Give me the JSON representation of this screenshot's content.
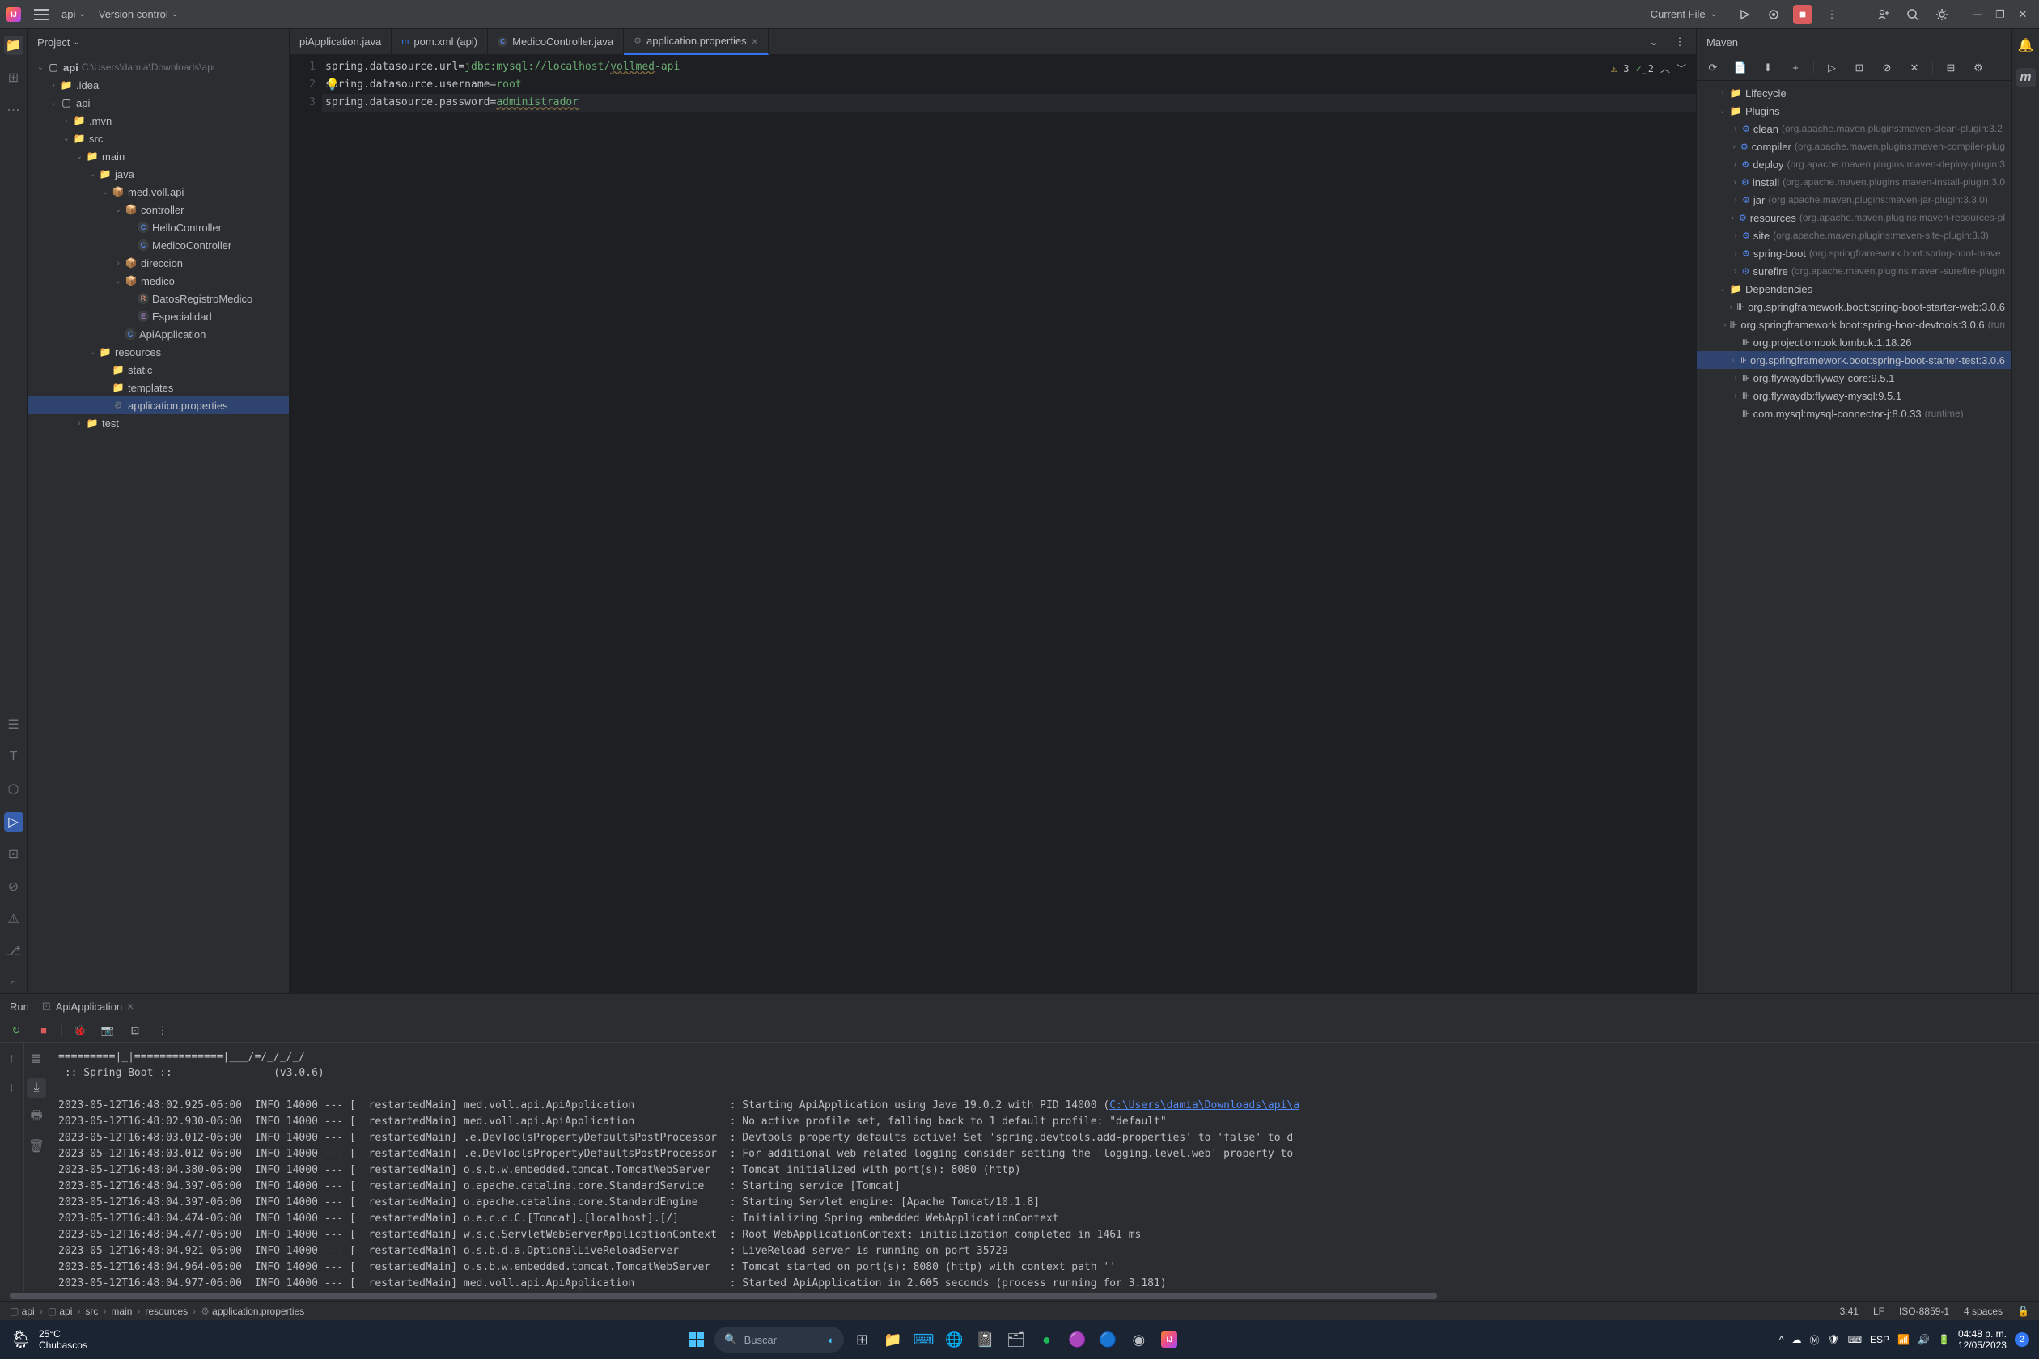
{
  "titlebar": {
    "menu_api": "api",
    "menu_vcs": "Version control",
    "run_config": "Current File",
    "logo_text": "IJ"
  },
  "project_panel": {
    "title": "Project",
    "root_name": "api",
    "root_path": "C:\\Users\\damia\\Downloads\\api",
    "nodes": {
      "idea": ".idea",
      "api": "api",
      "mvn": ".mvn",
      "src": "src",
      "main": "main",
      "java": "java",
      "pkg": "med.voll.api",
      "controller": "controller",
      "hello": "HelloController",
      "medicoc": "MedicoController",
      "direccion": "direccion",
      "medico": "medico",
      "datos": "DatosRegistroMedico",
      "especialidad": "Especialidad",
      "apiapp": "ApiApplication",
      "resources": "resources",
      "static": "static",
      "templates": "templates",
      "appprops": "application.properties",
      "test": "test"
    }
  },
  "tabs": {
    "t1": "piApplication.java",
    "t2": "pom.xml (api)",
    "t3": "MedicoController.java",
    "t4": "application.properties"
  },
  "editor": {
    "lines": [
      "1",
      "2",
      "3"
    ],
    "l1_key": "spring.datasource.url=",
    "l1_val1": "jdbc:mysql://localhost/",
    "l1_val2": "vollmed",
    "l1_val3": "-api",
    "l2_key": "spring.datasource.username=",
    "l2_val": "root",
    "l3_key": "spring.datasource.password=",
    "l3_val": "administrador",
    "warn_count": "3",
    "typo_count": "2"
  },
  "maven": {
    "title": "Maven",
    "lifecycle": "Lifecycle",
    "plugins": "Plugins",
    "plugin_items": [
      {
        "name": "clean",
        "desc": "(org.apache.maven.plugins:maven-clean-plugin:3.2"
      },
      {
        "name": "compiler",
        "desc": "(org.apache.maven.plugins:maven-compiler-plug"
      },
      {
        "name": "deploy",
        "desc": "(org.apache.maven.plugins:maven-deploy-plugin:3"
      },
      {
        "name": "install",
        "desc": "(org.apache.maven.plugins:maven-install-plugin:3.0"
      },
      {
        "name": "jar",
        "desc": "(org.apache.maven.plugins:maven-jar-plugin:3.3.0)"
      },
      {
        "name": "resources",
        "desc": "(org.apache.maven.plugins:maven-resources-pl"
      },
      {
        "name": "site",
        "desc": "(org.apache.maven.plugins:maven-site-plugin:3.3)"
      },
      {
        "name": "spring-boot",
        "desc": "(org.springframework.boot:spring-boot-mave"
      },
      {
        "name": "surefire",
        "desc": "(org.apache.maven.plugins:maven-surefire-plugin"
      }
    ],
    "dependencies": "Dependencies",
    "dep_items": [
      {
        "name": "org.springframework.boot:spring-boot-starter-web:3.0.6",
        "exp": true
      },
      {
        "name": "org.springframework.boot:spring-boot-devtools:3.0.6",
        "desc": "(run",
        "exp": true
      },
      {
        "name": "org.projectlombok:lombok:1.18.26",
        "exp": false
      },
      {
        "name": "org.springframework.boot:spring-boot-starter-test:3.0.6",
        "exp": true,
        "selected": true
      },
      {
        "name": "org.flywaydb:flyway-core:9.5.1",
        "exp": true
      },
      {
        "name": "org.flywaydb:flyway-mysql:9.5.1",
        "exp": true
      },
      {
        "name": "com.mysql:mysql-connector-j:8.0.33",
        "desc": "(runtime)",
        "exp": false
      }
    ]
  },
  "run": {
    "title": "Run",
    "tab_name": "ApiApplication",
    "banner1": "=========|_|==============|___/=/_/_/_/",
    "banner2": " :: Spring Boot ::                (v3.0.6)",
    "log_lines": [
      {
        "ts": "2023-05-12T16:48:02.925-06:00",
        "lvl": "INFO 14000 --- [  restartedMain]",
        "logger": "med.voll.api.ApiApplication              ",
        "msg": ": Starting ApiApplication using Java 19.0.2 with PID 14000 (",
        "link": "C:\\Users\\damia\\Downloads\\api\\a"
      },
      {
        "ts": "2023-05-12T16:48:02.930-06:00",
        "lvl": "INFO 14000 --- [  restartedMain]",
        "logger": "med.voll.api.ApiApplication              ",
        "msg": ": No active profile set, falling back to 1 default profile: \"default\""
      },
      {
        "ts": "2023-05-12T16:48:03.012-06:00",
        "lvl": "INFO 14000 --- [  restartedMain]",
        "logger": ".e.DevToolsPropertyDefaultsPostProcessor ",
        "msg": ": Devtools property defaults active! Set 'spring.devtools.add-properties' to 'false' to d"
      },
      {
        "ts": "2023-05-12T16:48:03.012-06:00",
        "lvl": "INFO 14000 --- [  restartedMain]",
        "logger": ".e.DevToolsPropertyDefaultsPostProcessor ",
        "msg": ": For additional web related logging consider setting the 'logging.level.web' property to"
      },
      {
        "ts": "2023-05-12T16:48:04.380-06:00",
        "lvl": "INFO 14000 --- [  restartedMain]",
        "logger": "o.s.b.w.embedded.tomcat.TomcatWebServer  ",
        "msg": ": Tomcat initialized with port(s): 8080 (http)"
      },
      {
        "ts": "2023-05-12T16:48:04.397-06:00",
        "lvl": "INFO 14000 --- [  restartedMain]",
        "logger": "o.apache.catalina.core.StandardService   ",
        "msg": ": Starting service [Tomcat]"
      },
      {
        "ts": "2023-05-12T16:48:04.397-06:00",
        "lvl": "INFO 14000 --- [  restartedMain]",
        "logger": "o.apache.catalina.core.StandardEngine    ",
        "msg": ": Starting Servlet engine: [Apache Tomcat/10.1.8]"
      },
      {
        "ts": "2023-05-12T16:48:04.474-06:00",
        "lvl": "INFO 14000 --- [  restartedMain]",
        "logger": "o.a.c.c.C.[Tomcat].[localhost].[/]       ",
        "msg": ": Initializing Spring embedded WebApplicationContext"
      },
      {
        "ts": "2023-05-12T16:48:04.477-06:00",
        "lvl": "INFO 14000 --- [  restartedMain]",
        "logger": "w.s.c.ServletWebServerApplicationContext ",
        "msg": ": Root WebApplicationContext: initialization completed in 1461 ms"
      },
      {
        "ts": "2023-05-12T16:48:04.921-06:00",
        "lvl": "INFO 14000 --- [  restartedMain]",
        "logger": "o.s.b.d.a.OptionalLiveReloadServer       ",
        "msg": ": LiveReload server is running on port 35729"
      },
      {
        "ts": "2023-05-12T16:48:04.964-06:00",
        "lvl": "INFO 14000 --- [  restartedMain]",
        "logger": "o.s.b.w.embedded.tomcat.TomcatWebServer  ",
        "msg": ": Tomcat started on port(s): 8080 (http) with context path ''"
      },
      {
        "ts": "2023-05-12T16:48:04.977-06:00",
        "lvl": "INFO 14000 --- [  restartedMain]",
        "logger": "med.voll.api.ApiApplication              ",
        "msg": ": Started ApiApplication in 2.605 seconds (process running for 3.181)"
      }
    ]
  },
  "statusbar": {
    "crumbs": [
      "api",
      "api",
      "src",
      "main",
      "resources",
      "application.properties"
    ],
    "pos": "3:41",
    "lf": "LF",
    "enc": "ISO-8859-1",
    "indent": "4 spaces"
  },
  "taskbar": {
    "temp": "25°C",
    "weather": "Chubascos",
    "search_placeholder": "Buscar",
    "time": "04:48 p. m.",
    "date": "12/05/2023",
    "lang": "ESP",
    "notif": "2"
  }
}
